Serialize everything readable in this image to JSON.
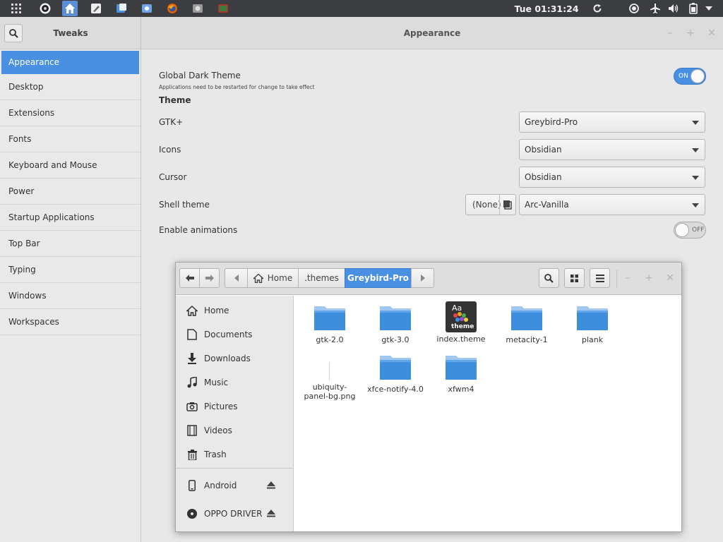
{
  "top_panel": {
    "clock": "Tue 01:31:24",
    "launchers": [
      "apps-grid-icon",
      "circle-app-icon",
      "home-folder-icon",
      "gimp-icon",
      "file-manager-icon",
      "settings-icon",
      "firefox-icon",
      "disks-icon",
      "photos-icon"
    ],
    "indicators": [
      "refresh-icon",
      "record-icon",
      "airplane-icon",
      "volume-icon",
      "battery-icon",
      "dropdown-icon"
    ]
  },
  "tweaks": {
    "title": "Tweaks",
    "page_title": "Appearance",
    "sidebar": [
      "Appearance",
      "Desktop",
      "Extensions",
      "Fonts",
      "Keyboard and Mouse",
      "Power",
      "Startup Applications",
      "Top Bar",
      "Typing",
      "Windows",
      "Workspaces"
    ],
    "dark_theme": {
      "label": "Global Dark Theme",
      "note": "Applications need to be restarted for change to take effect",
      "state": "ON"
    },
    "theme_heading": "Theme",
    "gtk": {
      "label": "GTK+",
      "value": "Greybird-Pro"
    },
    "icons": {
      "label": "Icons",
      "value": "Obsidian"
    },
    "cursor": {
      "label": "Cursor",
      "value": "Obsidian"
    },
    "shell": {
      "label": "Shell theme",
      "none": "(None)",
      "value": "Arc-Vanilla"
    },
    "animations": {
      "label": "Enable animations",
      "state": "OFF"
    }
  },
  "file_manager": {
    "breadcrumb": [
      "Home",
      ".themes",
      "Greybird-Pro"
    ],
    "sidebar": [
      "Home",
      "Documents",
      "Downloads",
      "Music",
      "Pictures",
      "Videos",
      "Trash"
    ],
    "devices": [
      "Android",
      "OPPO DRIVER"
    ],
    "files": [
      {
        "name": "gtk-2.0",
        "type": "folder"
      },
      {
        "name": "gtk-3.0",
        "type": "folder"
      },
      {
        "name": "index.theme",
        "type": "theme"
      },
      {
        "name": "metacity-1",
        "type": "folder"
      },
      {
        "name": "plank",
        "type": "folder"
      },
      {
        "name": "ubiquity-panel-bg.png",
        "type": "image"
      },
      {
        "name": "xfce-notify-4.0",
        "type": "folder"
      },
      {
        "name": "xfwm4",
        "type": "folder"
      }
    ],
    "theme_icon_text": {
      "top": "Aa",
      "bottom": "theme"
    }
  },
  "colors": {
    "accent": "#4a90e2",
    "panel": "#3b3d40",
    "folder": "#3d8fde"
  }
}
